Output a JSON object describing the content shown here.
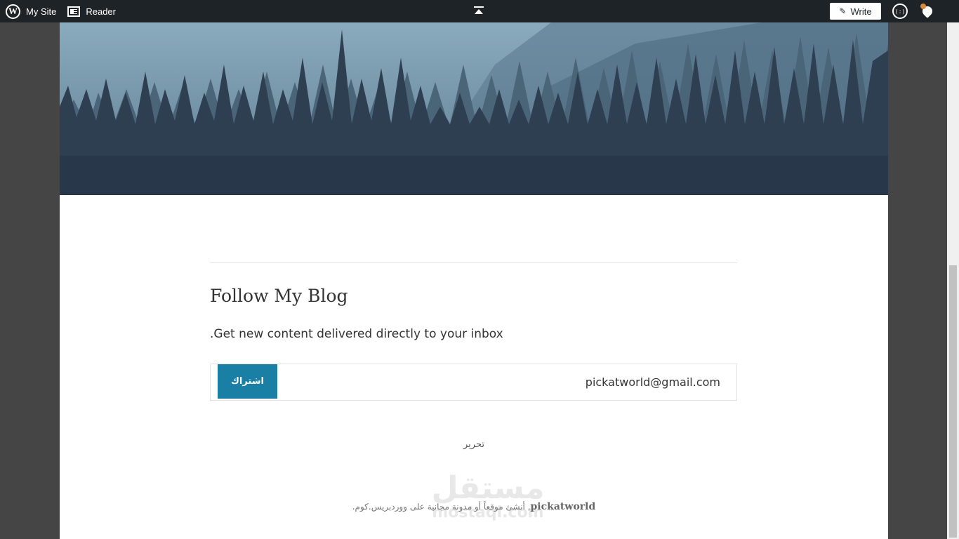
{
  "adminbar": {
    "my_site": "My Site",
    "reader": "Reader",
    "write": "Write"
  },
  "icons": {
    "wp_logo": "W",
    "avatar": "(:)"
  },
  "follow": {
    "title": "Follow My Blog",
    "subtitle": ".Get new content delivered directly to your inbox",
    "email_value": "pickatworld@gmail.com",
    "subscribe_label": "اشتراك"
  },
  "edit_link": "تحرير",
  "footer": {
    "brand": "pickatworld",
    "note": ", أنشئ موقعاً أو مدونة مجانية على ووردبريس.كوم."
  },
  "watermark": {
    "arabic": "مستقل",
    "latin": "mostaql.com"
  },
  "colors": {
    "admin_bar": "#1d2327",
    "subscribe_button": "#1a7fa5",
    "page_background": "#ffffff",
    "body_background": "#454545"
  }
}
